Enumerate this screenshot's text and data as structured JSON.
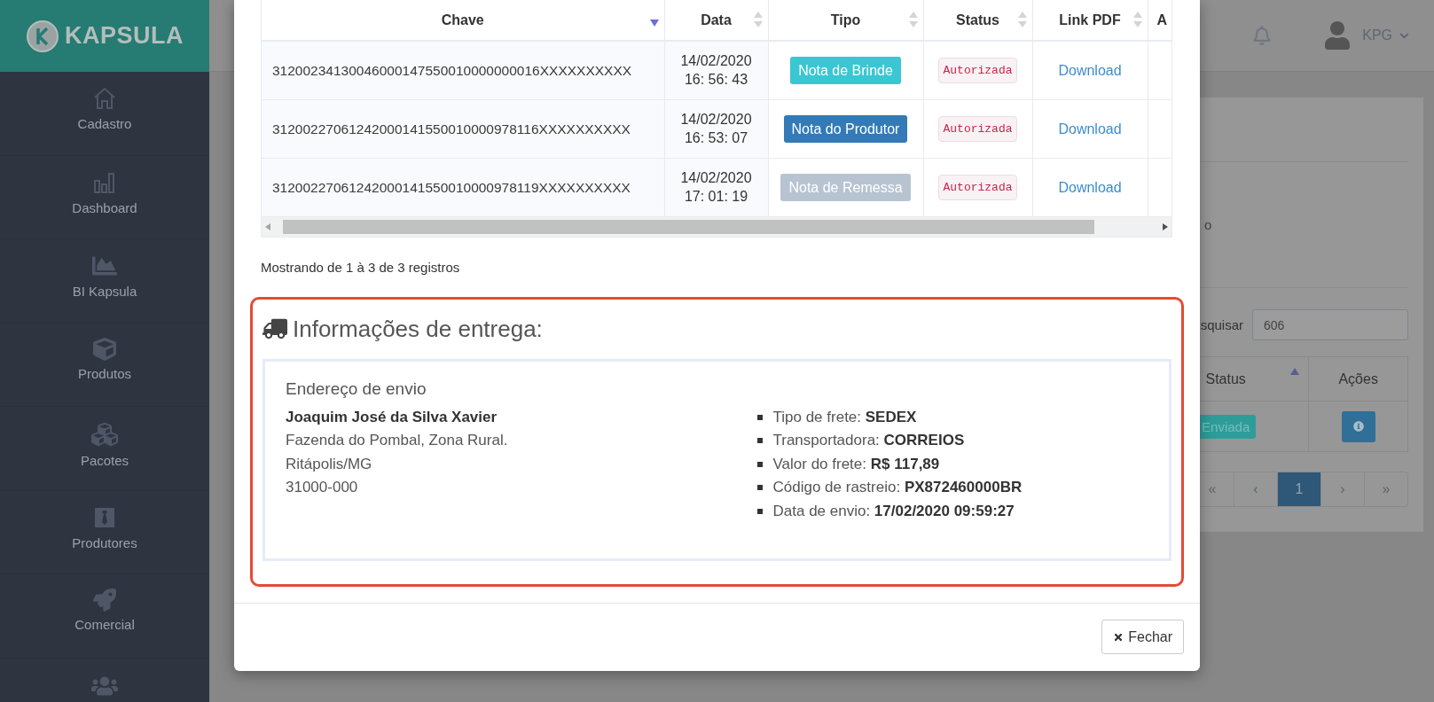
{
  "sidebar": {
    "logo": "KAPSULA",
    "items": [
      {
        "label": "Cadastro"
      },
      {
        "label": "Dashboard"
      },
      {
        "label": "BI Kapsula"
      },
      {
        "label": "Produtos"
      },
      {
        "label": "Pacotes"
      },
      {
        "label": "Produtores"
      },
      {
        "label": "Comercial"
      }
    ]
  },
  "background": {
    "user": "KPG",
    "fragment": "o",
    "search": {
      "label": "squisar",
      "value": "606"
    },
    "table": {
      "columns": [
        {
          "label": "Status",
          "sorted": true,
          "descending": false
        },
        {
          "label": "Ações",
          "sorted": false
        }
      ],
      "rows": [
        {
          "status": "Enviada"
        }
      ]
    },
    "pagination": [
      {
        "label": "«",
        "selected": false
      },
      {
        "label": "‹",
        "selected": false
      },
      {
        "label": "1",
        "selected": true
      },
      {
        "label": "›",
        "selected": false
      },
      {
        "label": "»",
        "selected": false
      }
    ]
  },
  "modal": {
    "table": {
      "columns": [
        {
          "label": "Chave",
          "sorted": true,
          "descending": true
        },
        {
          "label": "Data",
          "sorted": false
        },
        {
          "label": "Tipo",
          "sorted": false
        },
        {
          "label": "Status",
          "sorted": false
        },
        {
          "label": "Link PDF",
          "sorted": false
        },
        {
          "label": "A"
        }
      ],
      "rows": [
        {
          "chave": "31200234130046000147550010000000016XXXXXXXXXX",
          "date": "14/02/2020",
          "time": "16: 56: 43",
          "tipo": {
            "label": "Nota de Brinde",
            "color": "#3bc6d3"
          },
          "status": "Autorizada",
          "link": "Download"
        },
        {
          "chave": "31200227061242000141550010000978116XXXXXXXXXX",
          "date": "14/02/2020",
          "time": "16: 53: 07",
          "tipo": {
            "label": "Nota do Produtor",
            "color": "#337ab7"
          },
          "status": "Autorizada",
          "link": "Download"
        },
        {
          "chave": "31200227061242000141550010000978119XXXXXXXXXX",
          "date": "14/02/2020",
          "time": "17: 01: 19",
          "tipo": {
            "label": "Nota de Remessa",
            "color": "#b8c3d2"
          },
          "status": "Autorizada",
          "link": "Download"
        }
      ]
    },
    "summary": "Mostrando de 1 à 3 de 3 registros",
    "delivery": {
      "title": "Informações de entrega:",
      "address_label": "Endereço de envio",
      "name": "Joaquim José da Silva Xavier",
      "lines": [
        "Fazenda do Pombal, Zona Rural.",
        "Ritápolis/MG",
        "31000-000"
      ],
      "details": [
        "Tipo de frete: **SEDEX**",
        "Transportadora: **CORREIOS**",
        "Valor do frete: **R$ 117,89**",
        "Código de rastreio: **PX872460000BR**",
        "Data de envio: **17/02/2020 09:59:27**"
      ]
    },
    "close_button": "Fechar"
  }
}
